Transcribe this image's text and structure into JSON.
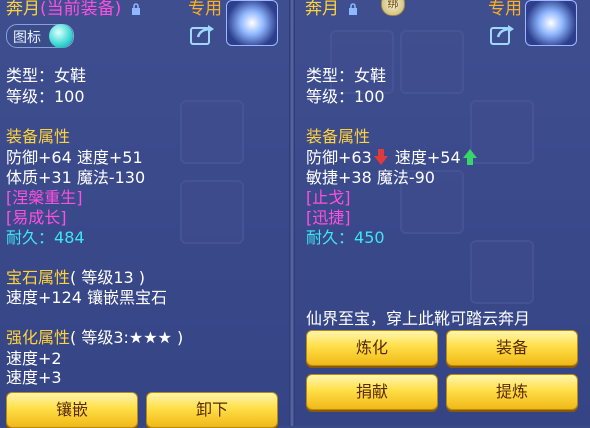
{
  "left": {
    "title": "奔月",
    "title_sub": "(当前装备)",
    "exclusive": "专用",
    "toggle_label": "图标",
    "type_line": "类型：女鞋",
    "level_line": "等级：100",
    "attr_header": "装备属性",
    "stats1": "防御+64  速度+51",
    "stats2": "体质+31  魔法-130",
    "special1": "[涅槃重生]",
    "special2": "[易成长]",
    "durability_label": "耐久：",
    "durability_value": "484",
    "gem_header": "宝石属性",
    "gem_level": "( 等级13 )",
    "gem_line": "速度+124  镶嵌黑宝石",
    "enhance_header": "强化属性",
    "enhance_level": "( 等级3:★★★ )",
    "enhance1": "速度+2",
    "enhance2": "速度+3",
    "buttons": {
      "inlay": "镶嵌",
      "unequip": "卸下"
    }
  },
  "right": {
    "title": "奔月",
    "exclusive": "专用",
    "badge": "绑",
    "type_line": "类型：女鞋",
    "level_line": "等级：100",
    "attr_header": "装备属性",
    "stat_def": "防御+63",
    "stat_spd": "速度+54",
    "stats2": "敏捷+38  魔法-90",
    "special1": "[止戈]",
    "special2": "[迅捷]",
    "durability_label": "耐久：",
    "durability_value": "450",
    "slogan": "仙界至宝，穿上此靴可踏云奔月",
    "buttons": {
      "refine": "炼化",
      "equip": "装备",
      "donate": "捐献",
      "extract": "提炼"
    }
  },
  "colors": {
    "gold": "#ffd23a",
    "magenta": "#ff4fe0",
    "cyan": "#3ee6f2",
    "arrow_down": "#e03a3a",
    "arrow_up": "#39d46a"
  },
  "icons": [
    "lock-icon",
    "share-icon",
    "arrow-down-icon",
    "arrow-up-icon",
    "avatar-icon"
  ]
}
